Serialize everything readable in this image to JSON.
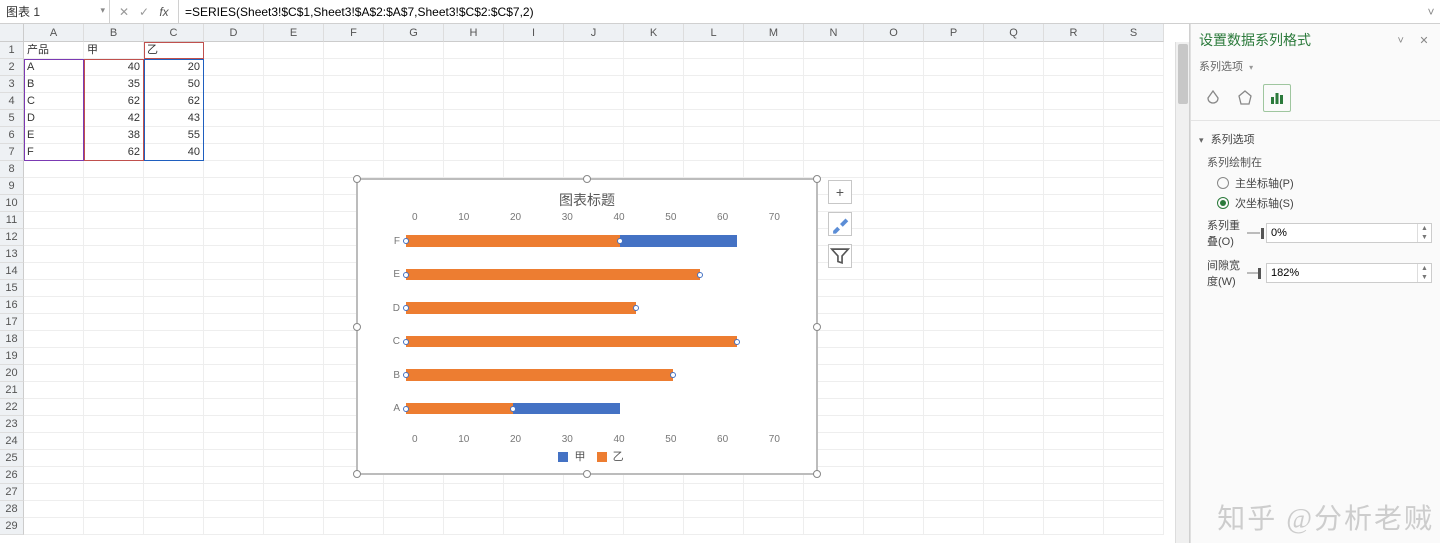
{
  "formula": {
    "name_box": "图表 1",
    "formula": "=SERIES(Sheet3!$C$1,Sheet3!$A$2:$A$7,Sheet3!$C$2:$C$7,2)"
  },
  "columns": [
    "A",
    "B",
    "C",
    "D",
    "E",
    "F",
    "G",
    "H",
    "I",
    "J",
    "K",
    "L",
    "M",
    "N",
    "O",
    "P",
    "Q",
    "R",
    "S"
  ],
  "row_count": 29,
  "cells": {
    "A1": "产品",
    "B1": "甲",
    "C1": "乙",
    "A2": "A",
    "B2": "40",
    "C2": "20",
    "A3": "B",
    "B3": "35",
    "C3": "50",
    "A4": "C",
    "B4": "62",
    "C4": "62",
    "A5": "D",
    "B5": "42",
    "C5": "43",
    "A6": "E",
    "B6": "38",
    "C6": "55",
    "A7": "F",
    "B7": "62",
    "C7": "40"
  },
  "chart_data": {
    "type": "bar",
    "title": "图表标题",
    "categories": [
      "A",
      "B",
      "C",
      "D",
      "E",
      "F"
    ],
    "display_order": [
      "F",
      "E",
      "D",
      "C",
      "B",
      "A"
    ],
    "series": [
      {
        "name": "甲",
        "color": "#4472c4",
        "values": [
          40,
          35,
          62,
          42,
          38,
          62
        ]
      },
      {
        "name": "乙",
        "color": "#ed7d31",
        "values": [
          20,
          50,
          62,
          43,
          55,
          40
        ]
      }
    ],
    "x_ticks": [
      0,
      10,
      20,
      30,
      40,
      50,
      60,
      70
    ],
    "xlim": [
      0,
      70
    ],
    "legend_position": "bottom",
    "selected_series": "乙"
  },
  "chart_buttons": {
    "plus": "+",
    "brush": "brush",
    "funnel": "funnel"
  },
  "panel": {
    "title": "设置数据系列格式",
    "dropdown_label": "系列选项",
    "section_label": "系列选项",
    "subhead": "系列绘制在",
    "radio_primary": "主坐标轴(P)",
    "radio_secondary": "次坐标轴(S)",
    "radio_selected": "secondary",
    "overlap_label": "系列重叠(O)",
    "overlap_value": "0%",
    "gap_label": "间隙宽度(W)",
    "gap_value": "182%"
  },
  "watermark": "知乎 @分析老贼"
}
